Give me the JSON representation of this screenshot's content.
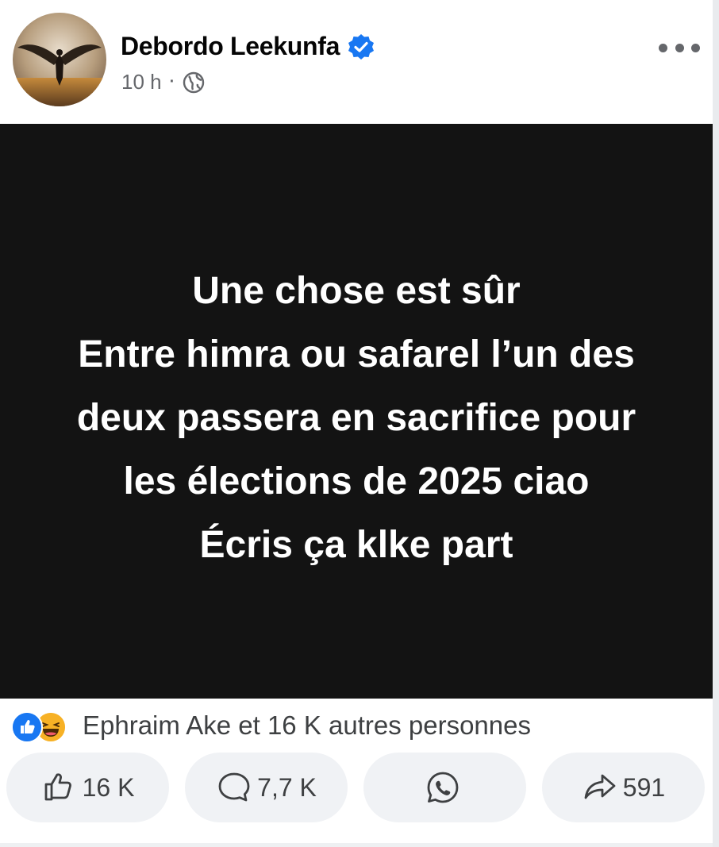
{
  "post": {
    "author": "Debordo Leekunfa",
    "verified_icon": "verified-badge-icon",
    "time": "10 h",
    "separator": "·",
    "privacy_icon": "globe-icon",
    "more_icon": "more-options-icon",
    "content_lines": [
      "Une chose est sûr",
      "Entre himra ou safarel l’un des",
      "deux passera en sacrifice pour",
      "les élections de 2025 ciao",
      "Écris ça klke part"
    ],
    "content_background": "#131313",
    "content_color": "#ffffff"
  },
  "reactions": {
    "icons": [
      "like-reaction-icon",
      "haha-reaction-icon"
    ],
    "summary": "Ephraim Ake et 16 K autres personnes"
  },
  "actions": {
    "like": {
      "icon": "thumbs-up-icon",
      "count": "16 K"
    },
    "comment": {
      "icon": "comment-icon",
      "count": "7,7 K"
    },
    "whatsapp": {
      "icon": "whatsapp-icon"
    },
    "share": {
      "icon": "share-arrow-icon",
      "count": "591"
    }
  },
  "colors": {
    "brand_blue": "#1877f2",
    "haha_yellow": "#f7b125",
    "secondary_text": "#65676b",
    "button_bg": "#f0f2f5"
  }
}
